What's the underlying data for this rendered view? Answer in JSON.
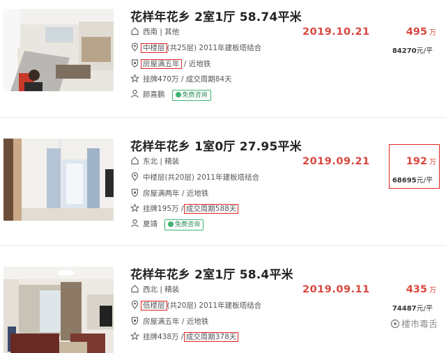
{
  "listings": [
    {
      "title": "花样年花乡 2室1厅 58.74平米",
      "orientation": "西南 | 其他",
      "floor_box": "中楼层",
      "floor_rest": "(共25层) 2011年建板塔结合",
      "tag_box": "房屋满五年",
      "tag_rest": " / 近地铁",
      "listing_info": "挂牌470万 / 成交周期84天",
      "agent": "颜喜鹏",
      "consult_label": "免费咨询",
      "deal_date": "2019.10.21",
      "total_price": "495",
      "price_unit": "万",
      "unit_price_num": "84270",
      "unit_price_suffix": "元/平"
    },
    {
      "title": "花样年花乡 1室0厅 27.95平米",
      "orientation": "东北 | 精装",
      "floor": "中楼层(共20层) 2011年建板塔结合",
      "tags": "房屋满两年 / 近地铁",
      "listing_price": "挂牌195万",
      "cycle_sep": " / ",
      "cycle_box": "成交周期588天",
      "agent": "夏靖",
      "consult_label": "免费咨询",
      "deal_date": "2019.09.21",
      "total_price": "192",
      "price_unit": "万",
      "unit_price_num": "68695",
      "unit_price_suffix": "元/平"
    },
    {
      "title": "花样年花乡 2室1厅 58.4平米",
      "orientation": "西北 | 精装",
      "floor_box": "低楼层",
      "floor_rest": "(共20层) 2011年建板塔结合",
      "tags": "房屋满五年 / 近地铁",
      "listing_price": "挂牌438万",
      "cycle_sep": " / ",
      "cycle_box": "成交周期378天",
      "deal_date": "2019.09.11",
      "total_price": "435",
      "price_unit": "万",
      "unit_price_num": "74487",
      "unit_price_suffix": "元/平"
    }
  ],
  "watermark": "楼市毒舌",
  "colors": {
    "accent": "#d9473f",
    "highlight_box": "#dd2222",
    "consult_green": "#3cb371"
  },
  "icons": [
    "home-icon",
    "location-pin-icon",
    "shield-icon",
    "star-icon",
    "person-icon",
    "wechat-icon"
  ]
}
